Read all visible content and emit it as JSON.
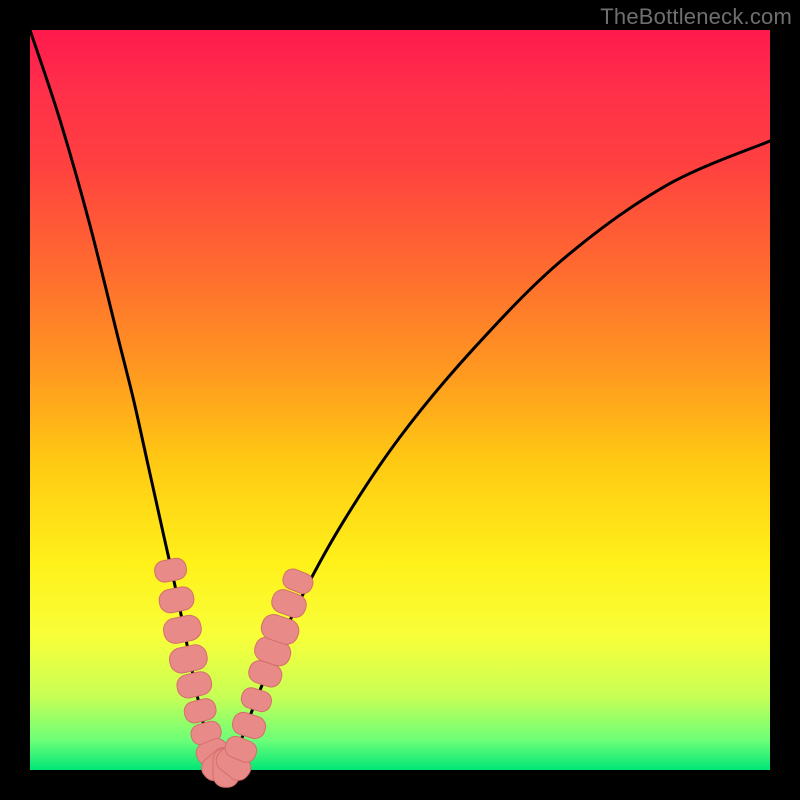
{
  "watermark": "TheBottleneck.com",
  "colors": {
    "curve": "#000000",
    "marker_fill": "#e88a87",
    "marker_stroke": "#d46f6c",
    "background_black": "#000000"
  },
  "chart_data": {
    "type": "line",
    "title": "",
    "xlabel": "",
    "ylabel": "",
    "xlim": [
      0,
      100
    ],
    "ylim": [
      0,
      100
    ],
    "grid": false,
    "series": [
      {
        "name": "bottleneck-curve",
        "x": [
          0,
          4,
          8,
          12,
          14,
          16,
          18,
          20,
          22,
          23.5,
          25,
          26,
          27,
          28.5,
          30,
          32,
          36,
          42,
          50,
          60,
          72,
          86,
          100
        ],
        "y": [
          100,
          88,
          74,
          58,
          50,
          41,
          32,
          23,
          13,
          6,
          1,
          0,
          1,
          4,
          8,
          13,
          22,
          33,
          45,
          57,
          69,
          79,
          85
        ],
        "note": "Percentage bottleneck vs relative hardware power; min at ~26%."
      }
    ],
    "markers": {
      "name": "highlighted-points",
      "shape": "rounded-rect",
      "points": [
        {
          "x": 19.0,
          "y": 27.0,
          "size": 1.6
        },
        {
          "x": 19.8,
          "y": 23.0,
          "size": 1.8
        },
        {
          "x": 20.6,
          "y": 19.0,
          "size": 2.0
        },
        {
          "x": 21.4,
          "y": 15.0,
          "size": 2.0
        },
        {
          "x": 22.2,
          "y": 11.5,
          "size": 1.8
        },
        {
          "x": 23.0,
          "y": 8.0,
          "size": 1.6
        },
        {
          "x": 23.8,
          "y": 5.0,
          "size": 1.5
        },
        {
          "x": 24.6,
          "y": 2.5,
          "size": 1.6
        },
        {
          "x": 25.5,
          "y": 0.8,
          "size": 1.9
        },
        {
          "x": 26.5,
          "y": 0.3,
          "size": 2.1
        },
        {
          "x": 27.5,
          "y": 0.8,
          "size": 1.9
        },
        {
          "x": 28.5,
          "y": 2.8,
          "size": 1.6
        },
        {
          "x": 29.6,
          "y": 6.0,
          "size": 1.7
        },
        {
          "x": 30.6,
          "y": 9.5,
          "size": 1.5
        },
        {
          "x": 31.8,
          "y": 13.0,
          "size": 1.7
        },
        {
          "x": 32.8,
          "y": 16.0,
          "size": 1.9
        },
        {
          "x": 33.8,
          "y": 19.0,
          "size": 2.0
        },
        {
          "x": 35.0,
          "y": 22.5,
          "size": 1.8
        },
        {
          "x": 36.2,
          "y": 25.5,
          "size": 1.5
        }
      ]
    }
  }
}
